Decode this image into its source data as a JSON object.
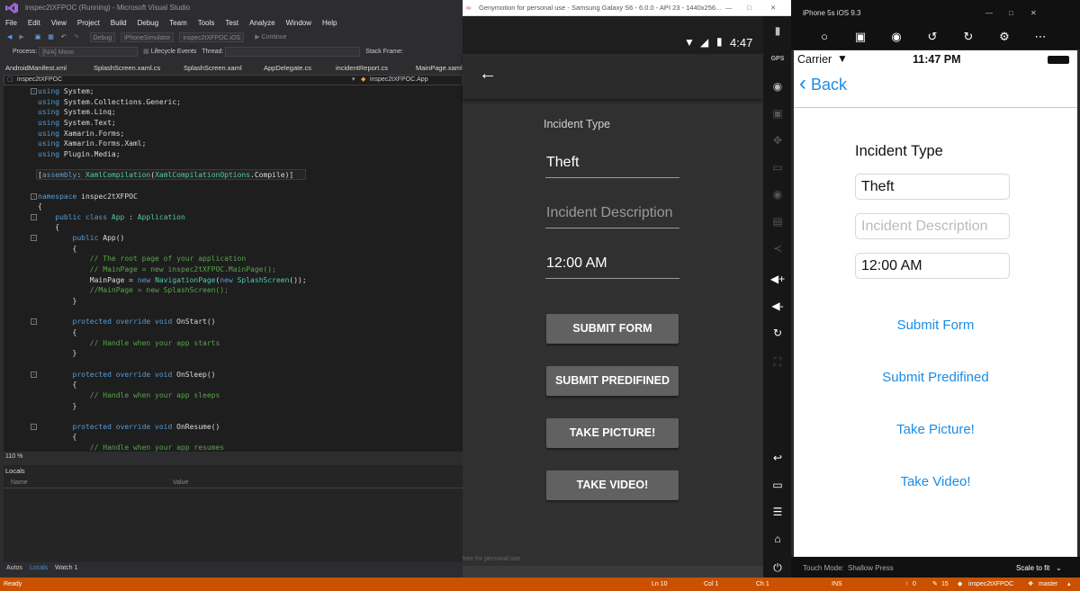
{
  "vs": {
    "title": "inspec2tXFPOC (Running) - Microsoft Visual Studio",
    "menu": [
      "File",
      "Edit",
      "View",
      "Project",
      "Build",
      "Debug",
      "Team",
      "Tools",
      "Test",
      "Analyze",
      "Window",
      "Help"
    ],
    "toolbar": {
      "config": "Debug",
      "platform": "iPhoneSimulator",
      "project": "inspec2tXFPOC.iOS",
      "continue": "Continue"
    },
    "process_label": "Process:",
    "process_value": "[N/A] Mono",
    "lifecycle": "Lifecycle Events",
    "thread_label": "Thread:",
    "stackframe_label": "Stack Frame:",
    "tabs": [
      "AndroidManifest.xml",
      "SplashScreen.xaml.cs",
      "SplashScreen.xaml",
      "AppDelegate.cs",
      "incidentReport.cs",
      "MainPage.xaml"
    ],
    "nav_left": "inspec2tXFPOC",
    "nav_right": "inspec2tXFPOC.App",
    "code": [
      [
        "kw:using",
        " System;"
      ],
      [
        "kw:using",
        " System.Collections.Generic;"
      ],
      [
        "kw:using",
        " System.Linq;"
      ],
      [
        "kw:using",
        " System.Text;"
      ],
      [
        "kw:using",
        " Xamarin.Forms;"
      ],
      [
        "kw:using",
        " Xamarin.Forms.Xaml;"
      ],
      [
        "kw:using",
        " Plugin.Media;"
      ],
      [
        ""
      ],
      [
        "[",
        "kw:assembly",
        ": ",
        "ty:XamlCompilation",
        "(",
        "ty:XamlCompilationOptions",
        ".Compile)]"
      ],
      [
        ""
      ],
      [
        "kw:namespace",
        " inspec2tXFPOC"
      ],
      [
        "{"
      ],
      [
        "    ",
        "kw:public class",
        " ",
        "ty:App",
        " : ",
        "ty:Application"
      ],
      [
        "    {"
      ],
      [
        "        ",
        "kw:public",
        " App()"
      ],
      [
        "        {"
      ],
      [
        "            ",
        "cm:// The root page of your application"
      ],
      [
        "            ",
        "cm:// MainPage = new inspec2tXFPOC.MainPage();"
      ],
      [
        "            MainPage = ",
        "kw:new",
        " ",
        "ty:NavigationPage",
        "(",
        "kw:new",
        " ",
        "ty:SplashScreen",
        "());"
      ],
      [
        "            ",
        "cm://MainPage = new SplashScreen();"
      ],
      [
        "        }"
      ],
      [
        ""
      ],
      [
        "        ",
        "kw:protected override void",
        " OnStart()"
      ],
      [
        "        {"
      ],
      [
        "            ",
        "cm:// Handle when your app starts"
      ],
      [
        "        }"
      ],
      [
        ""
      ],
      [
        "        ",
        "kw:protected override void",
        " OnSleep()"
      ],
      [
        "        {"
      ],
      [
        "            ",
        "cm:// Handle when your app sleeps"
      ],
      [
        "        }"
      ],
      [
        ""
      ],
      [
        "        ",
        "kw:protected override void",
        " OnResume()"
      ],
      [
        "        {"
      ],
      [
        "            ",
        "cm:// Handle when your app resumes"
      ]
    ],
    "zoom": "110 %",
    "locals_title": "Locals",
    "col_name": "Name",
    "col_value": "Value",
    "bottom_tabs": [
      "Autos",
      "Locals",
      "Watch 1"
    ],
    "status": {
      "ready": "Ready",
      "ln": "Ln 10",
      "col": "Col 1",
      "ch": "Ch 1",
      "ins": "INS",
      "up": "0",
      "pencil": "15",
      "repo": "inspec2tXFPOC",
      "branch": "master"
    }
  },
  "android": {
    "title": "Genymotion for personal use - Samsung Galaxy S6 - 6.0.0 - API 23 - 1440x256...",
    "time": "4:47",
    "label": "Incident Type",
    "field1": "Theft",
    "field2_placeholder": "Incident Description",
    "field3": "12:00 AM",
    "buttons": [
      "SUBMIT FORM",
      "SUBMIT PREDIFINED",
      "TAKE PICTURE!",
      "TAKE VIDEO!"
    ],
    "watermark": "free for personal use",
    "gps": "GPS"
  },
  "ios": {
    "title": "iPhone 5s iOS 9.3",
    "carrier": "Carrier",
    "time": "11:47 PM",
    "back": "Back",
    "label": "Incident Type",
    "field1": "Theft",
    "field2_placeholder": "Incident Description",
    "field3": "12:00 AM",
    "links": [
      "Submit Form",
      "Submit Predifined",
      "Take Picture!",
      "Take Video!"
    ],
    "touch_mode_label": "Touch Mode:",
    "touch_mode": "Shallow Press",
    "scale": "Scale to fit"
  }
}
